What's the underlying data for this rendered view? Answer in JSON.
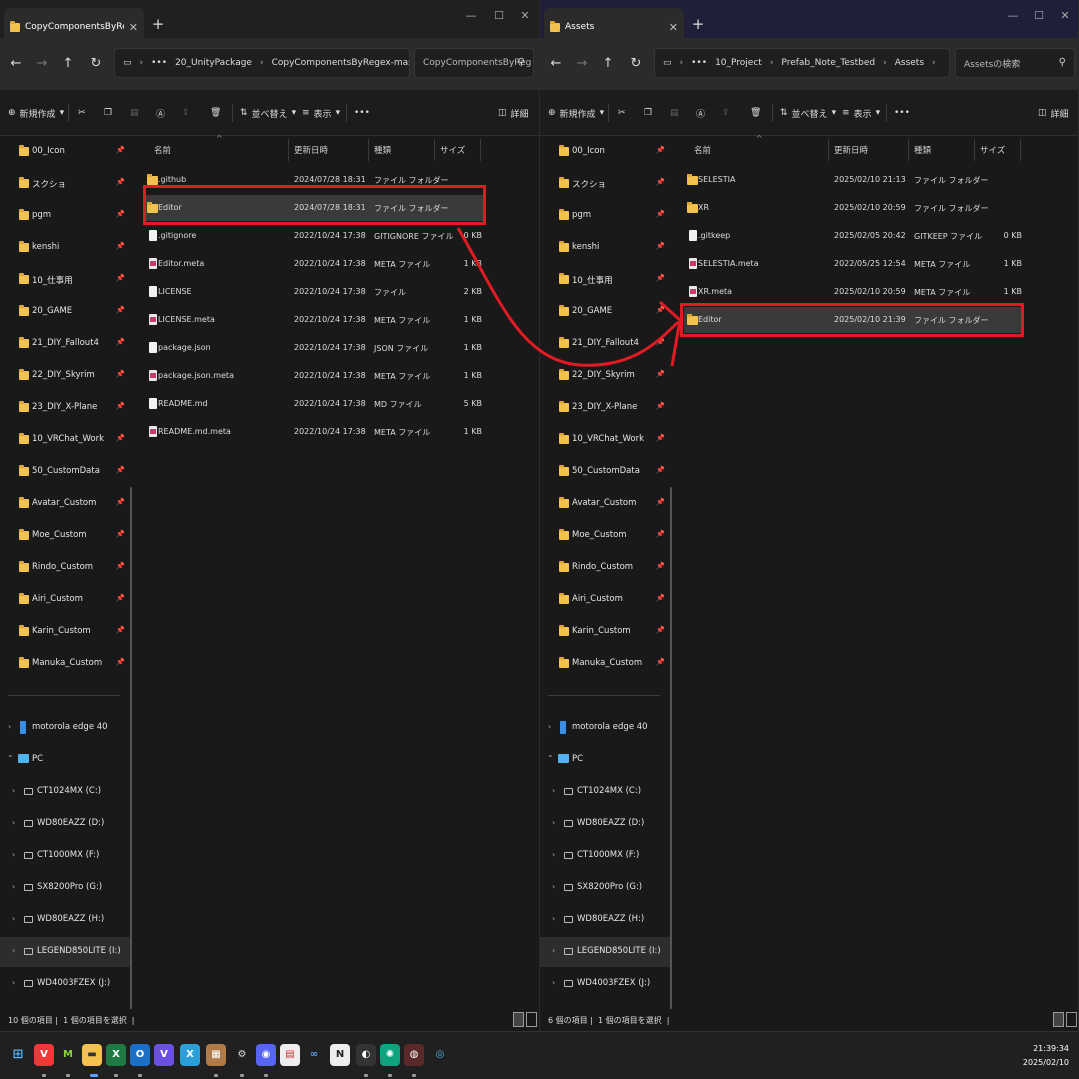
{
  "left": {
    "tab_title": "CopyComponentsByRegex-ma",
    "breadcrumb": [
      "20_UnityPackage",
      "CopyComponentsByRegex-master"
    ],
    "search_placeholder": "CopyComponentsByReg",
    "status_count": "10 個の項目",
    "status_selected": "1 個の項目を選択",
    "rows": [
      {
        "name": ".github",
        "date": "2024/07/28 18:31",
        "type": "ファイル フォルダー",
        "size": "",
        "icon": "folder-icon"
      },
      {
        "name": "Editor",
        "date": "2024/07/28 18:31",
        "type": "ファイル フォルダー",
        "size": "",
        "icon": "folder-icon"
      },
      {
        "name": ".gitignore",
        "date": "2022/10/24 17:38",
        "type": "GITIGNORE ファイル",
        "size": "0 KB",
        "icon": "file-icon"
      },
      {
        "name": "Editor.meta",
        "date": "2022/10/24 17:38",
        "type": "META ファイル",
        "size": "1 KB",
        "icon": "meta-file-icon"
      },
      {
        "name": "LICENSE",
        "date": "2022/10/24 17:38",
        "type": "ファイル",
        "size": "2 KB",
        "icon": "file-icon"
      },
      {
        "name": "LICENSE.meta",
        "date": "2022/10/24 17:38",
        "type": "META ファイル",
        "size": "1 KB",
        "icon": "meta-file-icon"
      },
      {
        "name": "package.json",
        "date": "2022/10/24 17:38",
        "type": "JSON ファイル",
        "size": "1 KB",
        "icon": "file-icon"
      },
      {
        "name": "package.json.meta",
        "date": "2022/10/24 17:38",
        "type": "META ファイル",
        "size": "1 KB",
        "icon": "meta-file-icon"
      },
      {
        "name": "README.md",
        "date": "2022/10/24 17:38",
        "type": "MD ファイル",
        "size": "5 KB",
        "icon": "file-icon"
      },
      {
        "name": "README.md.meta",
        "date": "2022/10/24 17:38",
        "type": "META ファイル",
        "size": "1 KB",
        "icon": "meta-file-icon"
      }
    ]
  },
  "right": {
    "tab_title": "Assets",
    "breadcrumb": [
      "10_Project",
      "Prefab_Note_Testbed",
      "Assets"
    ],
    "search_placeholder": "Assetsの検索",
    "status_count": "6 個の項目",
    "status_selected": "1 個の項目を選択",
    "rows": [
      {
        "name": "SELESTIA",
        "date": "2025/02/10 21:13",
        "type": "ファイル フォルダー",
        "size": "",
        "icon": "folder-icon"
      },
      {
        "name": "XR",
        "date": "2025/02/10 20:59",
        "type": "ファイル フォルダー",
        "size": "",
        "icon": "folder-icon"
      },
      {
        "name": ".gitkeep",
        "date": "2025/02/05 20:42",
        "type": "GITKEEP ファイル",
        "size": "0 KB",
        "icon": "file-icon"
      },
      {
        "name": "SELESTIA.meta",
        "date": "2022/05/25 12:54",
        "type": "META ファイル",
        "size": "1 KB",
        "icon": "meta-file-icon"
      },
      {
        "name": "XR.meta",
        "date": "2025/02/10 20:59",
        "type": "META ファイル",
        "size": "1 KB",
        "icon": "meta-file-icon"
      },
      {
        "name": "Editor",
        "date": "2025/02/10 21:39",
        "type": "ファイル フォルダー",
        "size": "",
        "icon": "folder-icon"
      }
    ]
  },
  "toolbar": {
    "new": "新規作成",
    "sort": "並べ替え",
    "view": "表示",
    "more": "•••",
    "details": "詳細"
  },
  "columns": {
    "name": "名前",
    "date": "更新日時",
    "type": "種類",
    "size": "サイズ"
  },
  "sidebar": {
    "pinned": [
      "00_Icon",
      "スクショ",
      "pgm",
      "kenshi",
      "10_仕事用",
      "20_GAME",
      "21_DIY_Fallout4",
      "22_DIY_Skyrim",
      "23_DIY_X-Plane",
      "10_VRChat_Work",
      "50_CustomData",
      "Avatar_Custom",
      "Moe_Custom",
      "Rindo_Custom",
      "Airi_Custom",
      "Karin_Custom",
      "Manuka_Custom"
    ],
    "device": "motorola edge 40",
    "pc": "PC",
    "drives": [
      "CT1024MX (C:)",
      "WD80EAZZ (D:)",
      "CT1000MX (F:)",
      "SX8200Pro (G:)",
      "WD80EAZZ (H:)",
      "LEGEND850LITE (I:)",
      "WD4003FZEX (J:)"
    ]
  },
  "taskbar": {
    "time": "21:39:34",
    "date": "2025/02/10"
  },
  "colors": {
    "highlight": "#e01b24",
    "folder": "#f2c14e"
  }
}
